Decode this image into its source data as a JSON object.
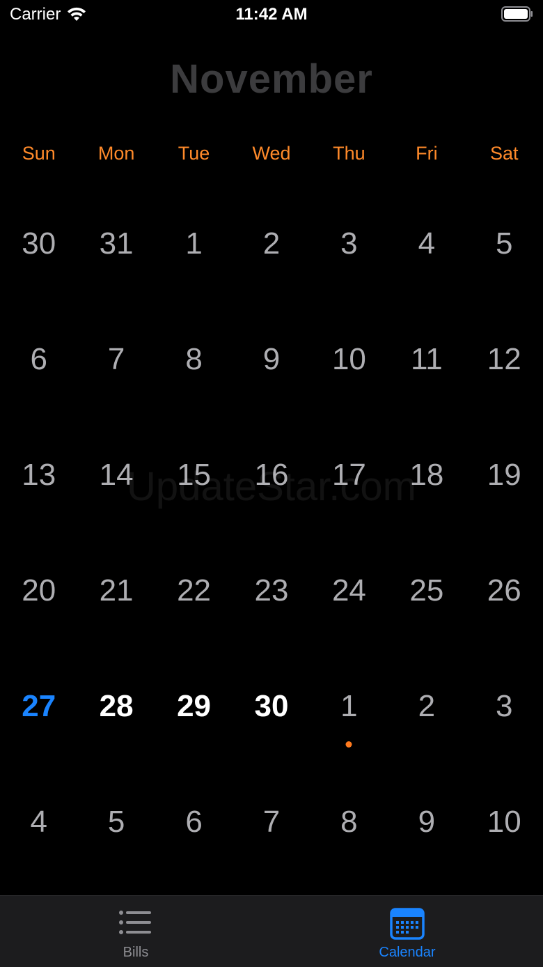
{
  "status_bar": {
    "carrier": "Carrier",
    "time": "11:42 AM"
  },
  "calendar": {
    "month_title": "November",
    "weekdays": [
      "Sun",
      "Mon",
      "Tue",
      "Wed",
      "Thu",
      "Fri",
      "Sat"
    ],
    "weeks": [
      [
        {
          "label": "30",
          "state": "other"
        },
        {
          "label": "31",
          "state": "other"
        },
        {
          "label": "1",
          "state": "other"
        },
        {
          "label": "2",
          "state": "other"
        },
        {
          "label": "3",
          "state": "other"
        },
        {
          "label": "4",
          "state": "other"
        },
        {
          "label": "5",
          "state": "other"
        }
      ],
      [
        {
          "label": "6",
          "state": "other"
        },
        {
          "label": "7",
          "state": "other"
        },
        {
          "label": "8",
          "state": "other"
        },
        {
          "label": "9",
          "state": "other"
        },
        {
          "label": "10",
          "state": "other"
        },
        {
          "label": "11",
          "state": "other"
        },
        {
          "label": "12",
          "state": "other"
        }
      ],
      [
        {
          "label": "13",
          "state": "other"
        },
        {
          "label": "14",
          "state": "other"
        },
        {
          "label": "15",
          "state": "other"
        },
        {
          "label": "16",
          "state": "other"
        },
        {
          "label": "17",
          "state": "other"
        },
        {
          "label": "18",
          "state": "other"
        },
        {
          "label": "19",
          "state": "other"
        }
      ],
      [
        {
          "label": "20",
          "state": "other"
        },
        {
          "label": "21",
          "state": "other"
        },
        {
          "label": "22",
          "state": "other"
        },
        {
          "label": "23",
          "state": "other"
        },
        {
          "label": "24",
          "state": "other"
        },
        {
          "label": "25",
          "state": "other"
        },
        {
          "label": "26",
          "state": "other"
        }
      ],
      [
        {
          "label": "27",
          "state": "today"
        },
        {
          "label": "28",
          "state": "current"
        },
        {
          "label": "29",
          "state": "current"
        },
        {
          "label": "30",
          "state": "current"
        },
        {
          "label": "1",
          "state": "other",
          "has_event": true
        },
        {
          "label": "2",
          "state": "other"
        },
        {
          "label": "3",
          "state": "other"
        }
      ],
      [
        {
          "label": "4",
          "state": "other"
        },
        {
          "label": "5",
          "state": "other"
        },
        {
          "label": "6",
          "state": "other"
        },
        {
          "label": "7",
          "state": "other"
        },
        {
          "label": "8",
          "state": "other"
        },
        {
          "label": "9",
          "state": "other"
        },
        {
          "label": "10",
          "state": "other"
        }
      ]
    ]
  },
  "watermark": "UpdateStar.com",
  "tab_bar": {
    "tabs": [
      {
        "label": "Bills",
        "icon": "list-icon",
        "active": false
      },
      {
        "label": "Calendar",
        "icon": "calendar-icon",
        "active": true
      }
    ]
  },
  "colors": {
    "accent": "#1a84ff",
    "weekday": "#ff8a2a",
    "event_dot": "#ff7a1e",
    "title": "#3c3c3e"
  }
}
